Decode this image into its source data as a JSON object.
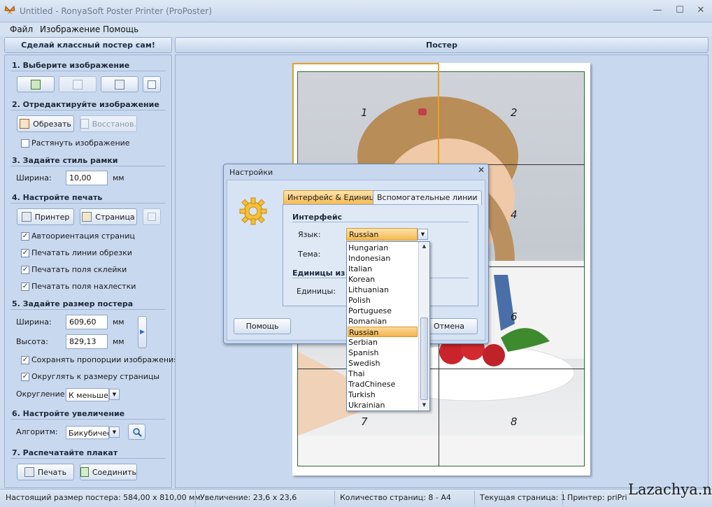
{
  "window": {
    "title": "Untitled - RonyaSoft Poster Printer (ProPoster)",
    "minimize": "—",
    "maximize": "☐",
    "close": "✕"
  },
  "menu": [
    "Файл",
    "Изображение",
    "Помощь"
  ],
  "headers": {
    "left": "Сделай классный постер сам!",
    "right": "Постер"
  },
  "left_panel": {
    "s1": "1. Выберите изображение",
    "s2": "2. Отредактируйте изображение",
    "crop": "Обрезать",
    "restore": "Восстанов.",
    "stretch": "Растянуть изображение",
    "s3": "3. Задайте стиль рамки",
    "frame_width_label": "Ширина:",
    "frame_width": "10,00",
    "frame_unit": "мм",
    "s4": "4. Настройте печать",
    "printer": "Принтер",
    "page": "Страница",
    "cb_autorient": "Автоориентация страниц",
    "cb_cutlines": "Печатать линии обрезки",
    "cb_glue": "Печатать поля склейки",
    "cb_overlap": "Печатать поля нахлестки",
    "s5": "5. Задайте размер постера",
    "width_label": "Ширина:",
    "width_val": "609,60",
    "height_label": "Высота:",
    "height_val": "829,13",
    "unit": "мм",
    "cb_keep": "Сохранять пропорции изображения",
    "cb_round": "Округлять к размеру страницы",
    "round_label": "Округление:",
    "round_val": "К меньшем",
    "s6": "6. Настройте увеличение",
    "algo_label": "Алгоритм:",
    "algo_val": "Бикубическ",
    "s7": "7. Распечатайте плакат",
    "print": "Печать",
    "join": "Соединить"
  },
  "page_numbers": [
    "1",
    "2",
    "4",
    "6",
    "7",
    "8"
  ],
  "dialog": {
    "title": "Настройки",
    "tab_active": "Интерфейс & Единицы",
    "tab_other": "Вспомогательные линии",
    "section_interface": "Интерфейс",
    "lang_label": "Язык:",
    "lang_value": "Russian",
    "theme_label": "Тема:",
    "section_units": "Единицы изм",
    "units_label": "Единицы:",
    "help": "Помощь",
    "cancel": "Отмена",
    "languages": [
      "Hungarian",
      "Indonesian",
      "Italian",
      "Korean",
      "Lithuanian",
      "Polish",
      "Portuguese",
      "Romanian",
      "Russian",
      "Serbian",
      "Spanish",
      "Swedish",
      "Thai",
      "TradChinese",
      "Turkish",
      "Ukrainian"
    ],
    "selected_language": "Russian"
  },
  "status": {
    "real_size": "Настоящий размер постера: 584,00 x 810,00 мм",
    "zoom": "Увеличение: 23,6 x 23,6",
    "pages": "Количество страниц: 8 - A4",
    "current": "Текущая страница: 1",
    "printer": "Принтер: priPrint"
  },
  "watermark": "Lazachya.net",
  "colors": {
    "selection": "#f3b44b",
    "panel": "#c8d8ef",
    "frame_green": "#2d6a2d",
    "page_highlight": "#e8a020"
  }
}
